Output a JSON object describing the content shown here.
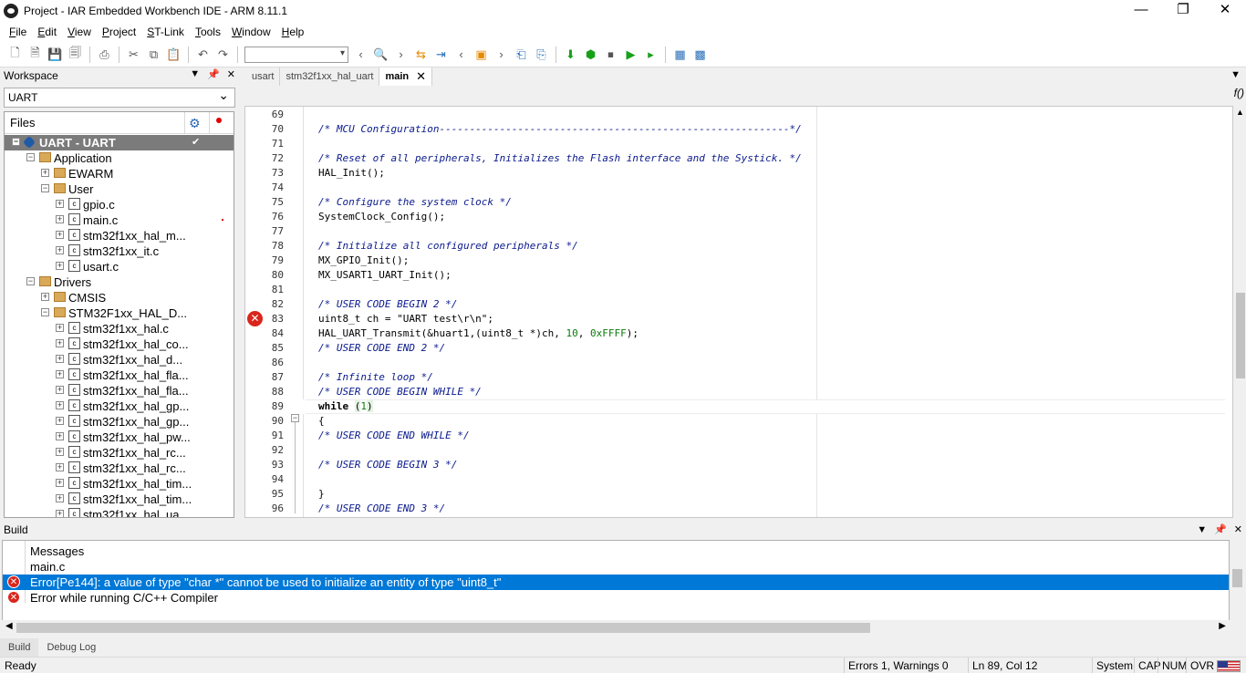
{
  "window": {
    "title": "Project - IAR Embedded Workbench IDE - ARM 8.11.1",
    "controls": [
      "—",
      "❐",
      "✕"
    ]
  },
  "menu": [
    "File",
    "Edit",
    "View",
    "Project",
    "ST-Link",
    "Tools",
    "Window",
    "Help"
  ],
  "workspace": {
    "title": "Workspace",
    "config": "UART",
    "files_header": "Files",
    "tree": [
      {
        "label": "UART - UART",
        "level": 0,
        "icon": "project",
        "selected": true
      },
      {
        "label": "Application",
        "level": 1,
        "icon": "folder"
      },
      {
        "label": "EWARM",
        "level": 2,
        "icon": "folder"
      },
      {
        "label": "User",
        "level": 2,
        "icon": "folder"
      },
      {
        "label": "gpio.c",
        "level": 3,
        "icon": "file"
      },
      {
        "label": "main.c",
        "level": 3,
        "icon": "file",
        "marked": true
      },
      {
        "label": "stm32f1xx_hal_m...",
        "level": 3,
        "icon": "file"
      },
      {
        "label": "stm32f1xx_it.c",
        "level": 3,
        "icon": "file"
      },
      {
        "label": "usart.c",
        "level": 3,
        "icon": "file"
      },
      {
        "label": "Drivers",
        "level": 1,
        "icon": "folder"
      },
      {
        "label": "CMSIS",
        "level": 2,
        "icon": "folder"
      },
      {
        "label": "STM32F1xx_HAL_D...",
        "level": 2,
        "icon": "folder"
      },
      {
        "label": "stm32f1xx_hal.c",
        "level": 3,
        "icon": "file"
      },
      {
        "label": "stm32f1xx_hal_co...",
        "level": 3,
        "icon": "file"
      },
      {
        "label": "stm32f1xx_hal_d...",
        "level": 3,
        "icon": "file"
      },
      {
        "label": "stm32f1xx_hal_fla...",
        "level": 3,
        "icon": "file"
      },
      {
        "label": "stm32f1xx_hal_fla...",
        "level": 3,
        "icon": "file"
      },
      {
        "label": "stm32f1xx_hal_gp...",
        "level": 3,
        "icon": "file"
      },
      {
        "label": "stm32f1xx_hal_gp...",
        "level": 3,
        "icon": "file"
      },
      {
        "label": "stm32f1xx_hal_pw...",
        "level": 3,
        "icon": "file"
      },
      {
        "label": "stm32f1xx_hal_rc...",
        "level": 3,
        "icon": "file"
      },
      {
        "label": "stm32f1xx_hal_rc...",
        "level": 3,
        "icon": "file"
      },
      {
        "label": "stm32f1xx_hal_tim...",
        "level": 3,
        "icon": "file"
      },
      {
        "label": "stm32f1xx_hal_tim...",
        "level": 3,
        "icon": "file"
      },
      {
        "label": "stm32f1xx_hal_ua...",
        "level": 3,
        "icon": "file"
      }
    ]
  },
  "editor": {
    "tabs": [
      "usart",
      "stm32f1xx_hal_uart",
      "main"
    ],
    "active_tab": "main",
    "func_icon": "f()",
    "lines": [
      {
        "n": "69",
        "html": ""
      },
      {
        "n": "70",
        "html": "<span class=\"cm\">/* MCU Configuration----------------------------------------------------------*/</span>"
      },
      {
        "n": "71",
        "html": ""
      },
      {
        "n": "72",
        "html": "<span class=\"cm\">/* Reset of all peripherals, Initializes the Flash interface and the Systick. */</span>"
      },
      {
        "n": "73",
        "html": "HAL_Init();"
      },
      {
        "n": "74",
        "html": ""
      },
      {
        "n": "75",
        "html": "<span class=\"cm\">/* Configure the system clock */</span>"
      },
      {
        "n": "76",
        "html": "SystemClock_Config();"
      },
      {
        "n": "77",
        "html": ""
      },
      {
        "n": "78",
        "html": "<span class=\"cm\">/* Initialize all configured peripherals */</span>"
      },
      {
        "n": "79",
        "html": "MX_GPIO_Init();"
      },
      {
        "n": "80",
        "html": "MX_USART1_UART_Init();"
      },
      {
        "n": "81",
        "html": ""
      },
      {
        "n": "82",
        "html": "<span class=\"cm\">/* USER CODE BEGIN 2 */</span>"
      },
      {
        "n": "83",
        "html": "uint8_t ch = \"UART test\\r\\n\";"
      },
      {
        "n": "84",
        "html": "HAL_UART_Transmit(&amp;huart1,(uint8_t *)ch, <span class=\"num\">10</span>, <span class=\"num\">0xFFFF</span>);"
      },
      {
        "n": "85",
        "html": "<span class=\"cm\">/* USER CODE END 2 */</span>"
      },
      {
        "n": "86",
        "html": ""
      },
      {
        "n": "87",
        "html": "<span class=\"cm\">/* Infinite loop */</span>"
      },
      {
        "n": "88",
        "html": "<span class=\"cm\">/* USER CODE BEGIN WHILE */</span>"
      },
      {
        "n": "89",
        "html": "<span class=\"kw\">while</span> <span class=\"br\">(</span><span class=\"num\">1</span><span class=\"br\">)</span>"
      },
      {
        "n": "90",
        "html": "{"
      },
      {
        "n": "91",
        "html": "<span class=\"cm\">/* USER CODE END WHILE */</span>"
      },
      {
        "n": "92",
        "html": ""
      },
      {
        "n": "93",
        "html": "<span class=\"cm\">/* USER CODE BEGIN 3 */</span>"
      },
      {
        "n": "94",
        "html": ""
      },
      {
        "n": "95",
        "html": "}"
      },
      {
        "n": "96",
        "html": "<span class=\"cm\">/* USER CODE END 3 */</span>"
      }
    ],
    "current_line": "89",
    "error_line": "83"
  },
  "build": {
    "title": "Build",
    "rows": [
      {
        "text": "Messages",
        "type": "header"
      },
      {
        "text": "main.c",
        "type": "file"
      },
      {
        "text": "Error[Pe144]: a value of type \"char *\" cannot be used to initialize an entity of type \"uint8_t\"",
        "type": "error",
        "selected": true
      },
      {
        "text": "Error while running C/C++ Compiler",
        "type": "error"
      }
    ]
  },
  "bottom_tabs": [
    "Build",
    "Debug Log"
  ],
  "status": {
    "ready": "Ready",
    "errors": "Errors 1, Warnings 0",
    "position": "Ln 89, Col 12",
    "system": "System",
    "cap": "CAP",
    "num": "NUM",
    "ovr": "OVR"
  }
}
